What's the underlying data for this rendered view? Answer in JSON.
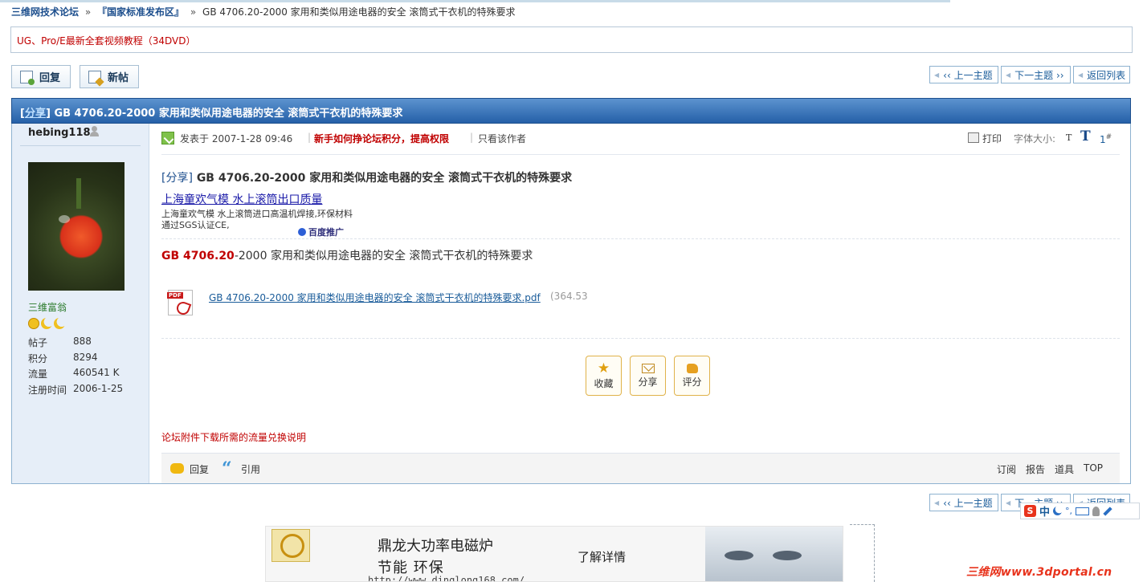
{
  "breadcrumb": {
    "site": "三维网技术论坛",
    "sep1": "»",
    "section": "『国家标准发布区』",
    "sep2": "»",
    "current": "GB 4706.20-2000 家用和类似用途电器的安全 滚筒式干衣机的特殊要求"
  },
  "notice": {
    "text": "UG、Pro/E最新全套视频教程（34DVD）"
  },
  "toolbar": {
    "reply_label": "回复",
    "newpost_label": "新帖"
  },
  "nav": {
    "prev": "‹‹ 上一主题",
    "next": "下一主题 ››",
    "back": "返回列表"
  },
  "thread": {
    "tag": "分享",
    "title": "GB 4706.20-2000 家用和类似用途电器的安全 滚筒式干衣机的特殊要求"
  },
  "author": {
    "name": "hebing118",
    "rank": "三维富翁",
    "stats": [
      {
        "label": "帖子",
        "value": "888"
      },
      {
        "label": "积分",
        "value": "8294"
      },
      {
        "label": "流量",
        "value": "460541 K"
      },
      {
        "label": "注册时间",
        "value": "2006-1-25"
      }
    ]
  },
  "post": {
    "posted_at": "发表于 2007-1-28 09:46",
    "sep": "|",
    "hint": "新手如何挣论坛积分，提高权限",
    "author_only": "只看该作者",
    "print": "打印",
    "font_size_label": "字体大小:",
    "font_small": "T",
    "font_large": "T",
    "floor": "1",
    "floor_mark": "#",
    "title_tag": "[分享]",
    "title": "GB 4706.20-2000 家用和类似用途电器的安全 滚筒式干衣机的特殊要求",
    "body_code": "GB 4706.20",
    "body_rest": "-2000 家用和类似用途电器的安全 滚筒式干衣机的特殊要求",
    "attachment_name": "GB 4706.20-2000 家用和类似用途电器的安全 滚筒式干衣机的特殊要求.pdf",
    "attachment_size": "(364.53",
    "footnote": "论坛附件下载所需的流量兑换说明"
  },
  "ad": {
    "title": "上海童欢气模 水上滚筒出口质量",
    "desc": "上海童欢气模 水上滚筒进口高温机焊接,环保材料通过SGS认证CE,",
    "provider": "百度推广"
  },
  "actions": {
    "favorite": "收藏",
    "share": "分享",
    "rate": "评分"
  },
  "action_bar": {
    "reply": "回复",
    "quote": "引用",
    "subscribe": "订阅",
    "report": "报告",
    "tools": "道具",
    "top": "TOP"
  },
  "ime": {
    "logo": "S",
    "lang": "中",
    "punct": "°,"
  },
  "banner": {
    "line1": "鼎龙大功率电磁炉",
    "line2": "节能 环保",
    "url": "http://www.dinglong168.com/",
    "more": "了解详情"
  },
  "watermark": "三维网www.3dportal.cn"
}
